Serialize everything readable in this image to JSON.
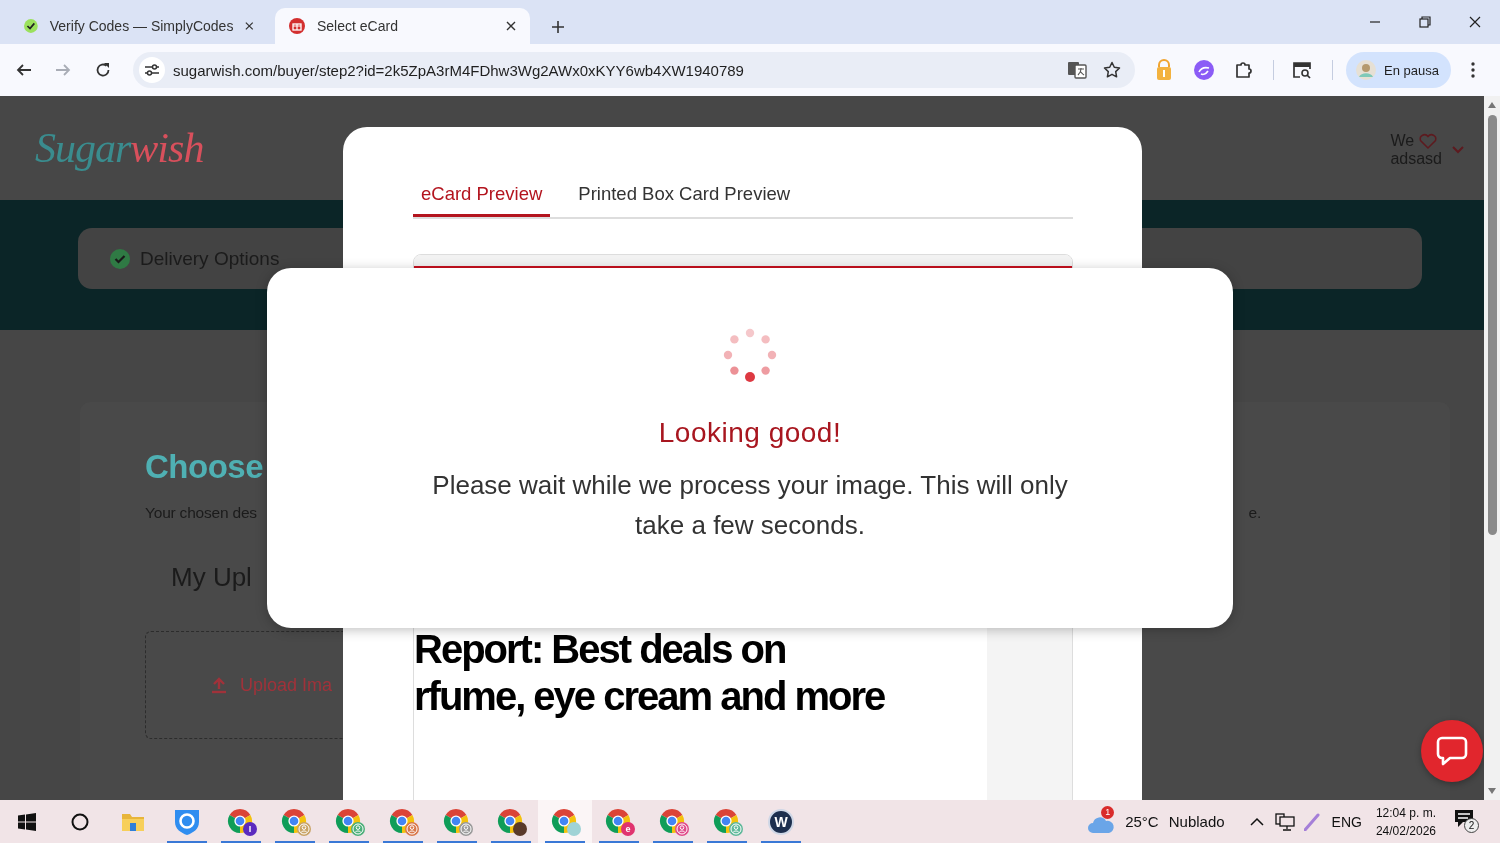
{
  "browser": {
    "tabs": [
      {
        "title": "Verify Codes — SimplyCodes",
        "selected": false
      },
      {
        "title": "Select eCard",
        "selected": true
      }
    ],
    "forward_disabled": true,
    "url": "sugarwish.com/buyer/step2?id=2k5ZpA3rM4FDhw3Wg2AWx0xKYY6wb4XW1940789",
    "profile": "En pausa"
  },
  "site": {
    "logo": {
      "first": "Sugar",
      "second": "wish"
    },
    "user": {
      "greeting": "We",
      "name": "adsasd"
    },
    "steps": [
      {
        "label": "Delivery Options",
        "done": true
      }
    ],
    "heading": "Choose",
    "description": "Your chosen des",
    "description_end": "e.",
    "section_title": "My Upl",
    "upload_button": "Upload Ima"
  },
  "modal": {
    "tabs": [
      {
        "label": "eCard Preview",
        "selected": true
      },
      {
        "label": "Printed Box Card Preview",
        "selected": false
      }
    ],
    "preview_lines": [
      "Report: Best deals on",
      "rfume, eye cream and more"
    ]
  },
  "dialog": {
    "title": "Looking good!",
    "message": "Please wait while we process your image. This will only take a few seconds."
  },
  "taskbar": {
    "apps": [
      {
        "kind": "start",
        "running": false,
        "selected": false
      },
      {
        "kind": "search",
        "running": false,
        "selected": false
      },
      {
        "kind": "folder",
        "running": false,
        "selected": false
      },
      {
        "kind": "shield",
        "running": true,
        "selected": false
      },
      {
        "kind": "chrome-letter",
        "badge_text": "I",
        "color": "#5b2bbf",
        "running": true,
        "selected": false
      },
      {
        "kind": "chrome-avatar",
        "color": "#c9a366",
        "running": true,
        "selected": false
      },
      {
        "kind": "chrome-avatar",
        "color": "#4caf7a",
        "running": true,
        "selected": false
      },
      {
        "kind": "chrome-avatar",
        "color": "#d9774a",
        "running": true,
        "selected": false
      },
      {
        "kind": "chrome-avatar",
        "color": "#9a9a9a",
        "running": true,
        "selected": false
      },
      {
        "kind": "chrome-photo",
        "color": "#5a3a2a",
        "running": true,
        "selected": false
      },
      {
        "kind": "chrome-photo",
        "color": "#9fd3d6",
        "running": true,
        "selected": true
      },
      {
        "kind": "chrome-letter",
        "badge_text": "e",
        "color": "#e0336f",
        "running": true,
        "selected": false
      },
      {
        "kind": "chrome-avatar",
        "color": "#e04a8a",
        "running": true,
        "selected": false
      },
      {
        "kind": "chrome-avatar",
        "color": "#5fb89a",
        "running": true,
        "selected": false
      },
      {
        "kind": "letter-app",
        "label": "W",
        "running": true,
        "selected": false
      }
    ]
  },
  "tray": {
    "weather_alert": "1",
    "temperature": "25°C",
    "condition": "Nublado",
    "language": "ENG",
    "time": "12:04 p. m.",
    "date": "24/02/2026",
    "notifications": "2"
  }
}
